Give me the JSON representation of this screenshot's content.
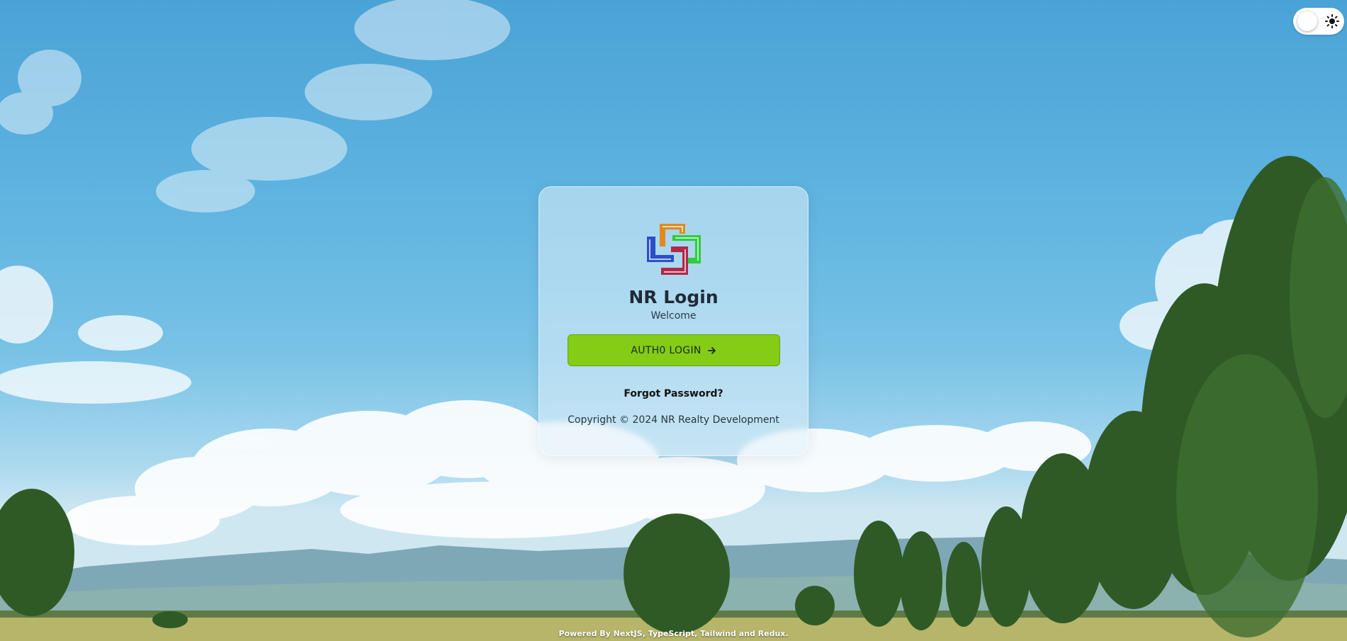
{
  "theme_toggle": {
    "icon": "sun-icon"
  },
  "login_card": {
    "logo_icon": "nr-logo-icon",
    "title": "NR Login",
    "subtitle": "Welcome",
    "login_button_label": "AUTH0 LOGIN",
    "login_button_icon": "arrow-right-icon",
    "forgot_password_label": "Forgot Password?",
    "copyright": "Copyright © 2024 NR Realty Development"
  },
  "footer": {
    "text": "Powered By NextJS, TypeScript, Tailwind and Redux."
  },
  "colors": {
    "accent": "#84cc16",
    "logo_orange": "#e08a1e",
    "logo_green": "#2ecc40",
    "logo_blue": "#2b4fc7",
    "logo_crimson": "#b0284a"
  }
}
